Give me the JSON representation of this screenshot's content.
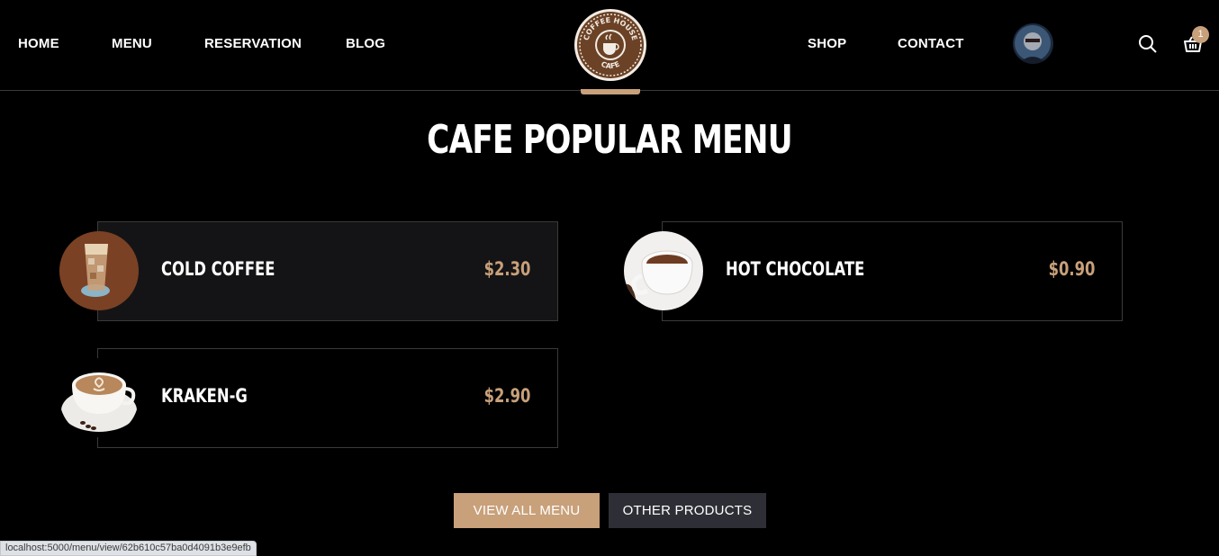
{
  "nav": {
    "left": [
      "HOME",
      "MENU",
      "RESERVATION",
      "BLOG"
    ],
    "right": [
      "SHOP",
      "CONTACT"
    ]
  },
  "logo": {
    "top_text": "COFFEE HOUSE",
    "bottom_text": "CAFE"
  },
  "cart": {
    "count": "1"
  },
  "icons": {
    "search": "search-icon",
    "cart": "basket-icon",
    "logo": "coffee-cup-logo"
  },
  "section": {
    "title": "CAFE POPULAR MENU"
  },
  "menu_items": [
    {
      "name": "COLD COFFEE",
      "price": "$2.30",
      "image": "iced-coffee-glass"
    },
    {
      "name": "HOT CHOCOLATE",
      "price": "$0.90",
      "image": "hot-chocolate-cup"
    },
    {
      "name": "KRAKEN-G",
      "price": "$2.90",
      "image": "latte-art-cup"
    }
  ],
  "buttons": {
    "view_all": "VIEW ALL MENU",
    "other": "OTHER PRODUCTS"
  },
  "status_url": "localhost:5000/menu/view/62b610c57ba0d4091b3e9efb",
  "colors": {
    "accent": "#c8a07a",
    "background": "#000000",
    "card_active": "#141416",
    "border": "#3a3a3a",
    "secondary_button": "#2e2f36"
  }
}
